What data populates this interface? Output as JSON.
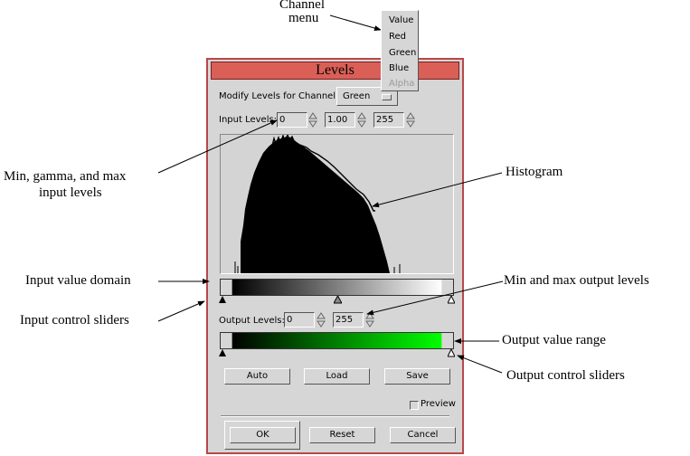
{
  "annotations": {
    "channel_menu_1": "Channel",
    "channel_menu_2": "menu",
    "min_gamma_max_1": "Min, gamma, and max",
    "min_gamma_max_2": "input levels",
    "histogram": "Histogram",
    "input_value_domain": "Input value domain",
    "min_max_output": "Min and max output levels",
    "input_control_sliders": "Input control sliders",
    "output_value_range": "Output value range",
    "output_control_sliders": "Output control sliders"
  },
  "dialog": {
    "title": "Levels",
    "channel_label": "Modify Levels for Channel:",
    "channel_value": "Green",
    "input_levels_label": "Input Levels:",
    "input_min": "0",
    "input_gamma": "1.00",
    "input_max": "255",
    "output_levels_label": "Output Levels:",
    "output_min": "0",
    "output_max": "255",
    "auto_label": "Auto",
    "load_label": "Load",
    "save_label": "Save",
    "preview_label": "Preview",
    "preview_checked": false,
    "ok_label": "OK",
    "reset_label": "Reset",
    "cancel_label": "Cancel"
  },
  "channel_menu": {
    "items": [
      "Value",
      "Red",
      "Green",
      "Blue",
      "Alpha"
    ],
    "disabled_item": "Alpha"
  },
  "colors": {
    "title_bar": "#d95f57",
    "dialog_bg": "#d6d6d6",
    "output_gradient_end": "#00ff00"
  }
}
